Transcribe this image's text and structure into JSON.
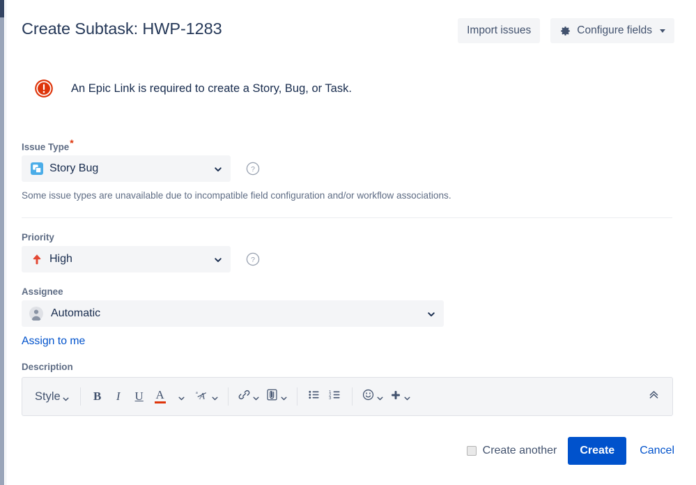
{
  "header": {
    "title": "Create Subtask: HWP-1283",
    "import_issues_label": "Import issues",
    "configure_fields_label": "Configure fields",
    "gear_icon": "gear-icon",
    "caret_icon": "chevron-down-icon"
  },
  "error": {
    "icon": "error-circle-icon",
    "message": "An Epic Link is required to create a Story, Bug, or Task."
  },
  "fields": {
    "issue_type": {
      "label": "Issue Type",
      "required_marker": "*",
      "value": "Story Bug",
      "icon": "subtask-issue-type-icon",
      "help_icon": "help-circle-icon",
      "hint": "Some issue types are unavailable due to incompatible field configuration and/or workflow associations."
    },
    "priority": {
      "label": "Priority",
      "value": "High",
      "icon": "priority-high-arrow-icon",
      "help_icon": "help-circle-icon"
    },
    "assignee": {
      "label": "Assignee",
      "value": "Automatic",
      "icon": "user-avatar-icon",
      "assign_to_me_label": "Assign to me"
    },
    "description": {
      "label": "Description",
      "toolbar": {
        "style_label": "Style",
        "bold_label": "B",
        "italic_label": "I",
        "underline_label": "U",
        "text_color_label": "A",
        "more_formatting_label": "A",
        "link_icon": "link-icon",
        "attach_icon": "attachment-icon",
        "bullet_list_icon": "bullet-list-icon",
        "numbered_list_icon": "numbered-list-icon",
        "emoji_icon": "emoji-icon",
        "insert_more_icon": "plus-icon",
        "collapse_icon": "double-chevron-up-icon"
      }
    }
  },
  "footer": {
    "create_another_label": "Create another",
    "create_another_checked": false,
    "create_label": "Create",
    "cancel_label": "Cancel"
  },
  "colors": {
    "primary": "#0052cc",
    "error": "#de350b",
    "text": "#172b4d",
    "muted": "#5e6c84",
    "field_bg": "#f4f5f7"
  }
}
